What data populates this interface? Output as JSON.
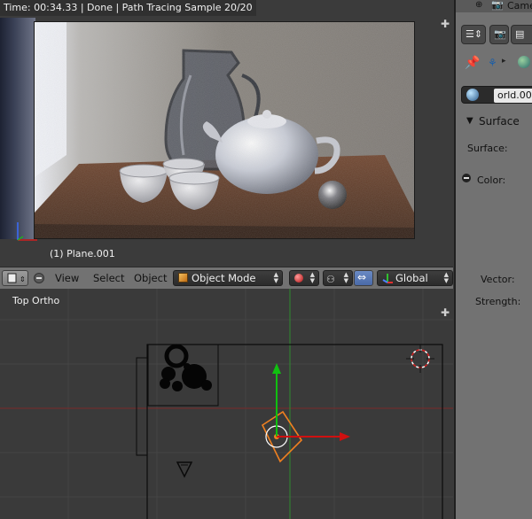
{
  "status": {
    "text": "Time: 00:34.33 | Done | Path Tracing Sample 20/20"
  },
  "render_view": {
    "active_object": "(1) Plane.001"
  },
  "header": {
    "menus": [
      "View",
      "Select",
      "Object"
    ],
    "mode": "Object Mode",
    "orientation": "Global"
  },
  "top_view": {
    "view_name": "Top Ortho"
  },
  "properties": {
    "top_item": "Came",
    "world_name": "orld.001",
    "panel_title": "Surface",
    "surface_label": "Surface:",
    "color_label": "Color:",
    "vector_label": "Vector:",
    "strength_label": "Strength:"
  },
  "colors": {
    "header_bg": "#727272",
    "axis_x": "#d01010",
    "axis_y": "#10c010",
    "selected": "#f08020",
    "grid_red": "#7a2a2a",
    "grid_green": "#2f7a2f"
  }
}
